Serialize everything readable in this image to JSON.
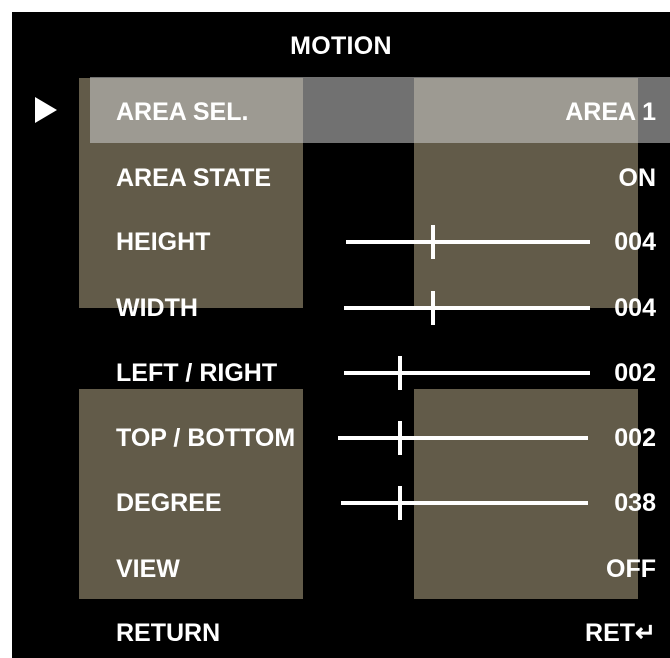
{
  "title": "MOTION",
  "rows": [
    {
      "label": "AREA SEL.",
      "value": "AREA 1"
    },
    {
      "label": "AREA STATE",
      "value": "ON"
    },
    {
      "label": "HEIGHT",
      "value": "004",
      "level": 4
    },
    {
      "label": "WIDTH",
      "value": "004",
      "level": 4
    },
    {
      "label": "LEFT / RIGHT",
      "value": "002",
      "level": 2
    },
    {
      "label": "TOP / BOTTOM",
      "value": "002",
      "level": 2
    },
    {
      "label": "DEGREE",
      "value": "038",
      "level": 38
    },
    {
      "label": "VIEW",
      "value": "OFF"
    }
  ],
  "return_row": {
    "label": "RETURN",
    "value": "RET↵"
  },
  "selected_row": 0,
  "cursor_icon": "play-arrow-icon",
  "colors": {
    "background": "#000000",
    "text": "#ffffff",
    "motion_area_overlay": "#716a55",
    "selection_highlight": "#cdcdcd"
  }
}
